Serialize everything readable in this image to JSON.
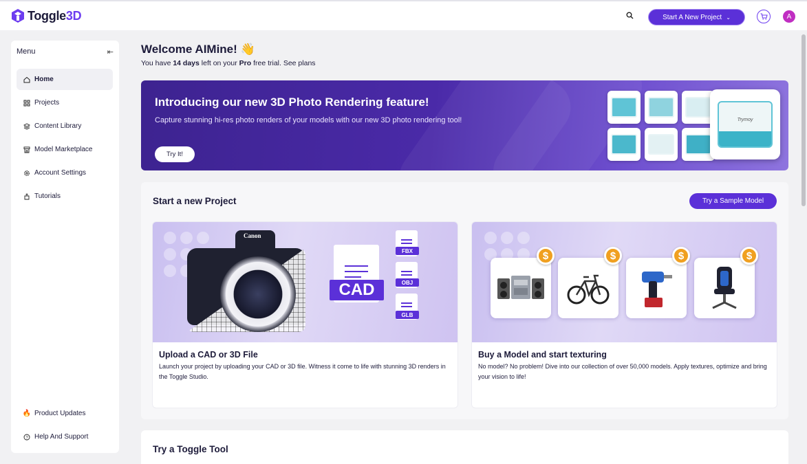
{
  "app": {
    "logo_text_1": "Toggle",
    "logo_text_2": "3D",
    "brand_color": "#5b30d8"
  },
  "header": {
    "start_project_label": "Start A New Project",
    "avatar_initial": "A"
  },
  "sidebar": {
    "menu_label": "Menu",
    "items": [
      {
        "label": "Home",
        "icon": "home-icon",
        "active": true
      },
      {
        "label": "Projects",
        "icon": "grid-icon"
      },
      {
        "label": "Content Library",
        "icon": "library-icon"
      },
      {
        "label": "Model Marketplace",
        "icon": "store-icon"
      },
      {
        "label": "Account Settings",
        "icon": "gear-icon"
      },
      {
        "label": "Tutorials",
        "icon": "tutorial-icon"
      }
    ],
    "bottom_items": [
      {
        "label": "Product Updates",
        "icon": "fire-icon"
      },
      {
        "label": "Help And Support",
        "icon": "help-icon"
      }
    ]
  },
  "welcome": {
    "title": "Welcome AIMine! 👋",
    "trial_prefix": "You have ",
    "trial_days": "14 days",
    "trial_mid": " left on your ",
    "trial_plan": "Pro",
    "trial_suffix": " free trial. See plans"
  },
  "banner": {
    "title": "Introducing our new 3D Photo Rendering feature!",
    "description": "Capture stunning hi-res photo renders of your models with our new 3D photo rendering tool!",
    "button": "Try It!",
    "featured_text": "Trymoy"
  },
  "new_project": {
    "title": "Start a new Project",
    "sample_button": "Try a Sample Model",
    "cards": [
      {
        "title": "Upload a CAD or 3D File",
        "description": "Launch your project by uploading your CAD or 3D file. Witness it come to life with stunning 3D renders in the Toggle Studio.",
        "camera_brand": "Canon",
        "big_file_label": "CAD",
        "file_labels": [
          "FBX",
          "OBJ",
          "GLB"
        ]
      },
      {
        "title": "Buy a Model and start texturing",
        "description": "No model? No problem! Dive into our collection of over 50,000 models. Apply textures, optimize and bring your vision to life!",
        "price_symbol": "$",
        "products": [
          "stereo-icon",
          "bicycle-icon",
          "drill-icon",
          "gaming-chair-icon"
        ]
      }
    ]
  },
  "tools": {
    "title": "Try a Toggle Tool"
  }
}
